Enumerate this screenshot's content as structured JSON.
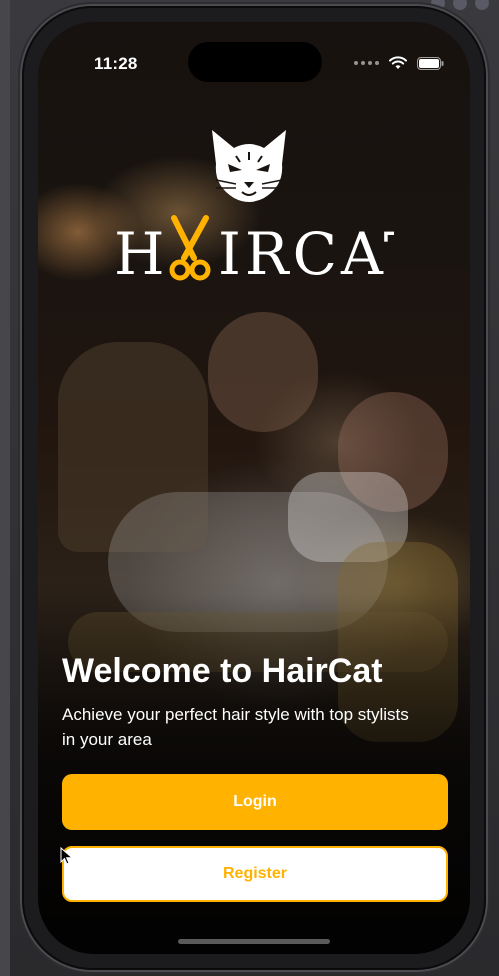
{
  "status_bar": {
    "time": "11:28",
    "signal_icon": "cellular-dots-icon",
    "wifi_icon": "wifi-icon",
    "battery_icon": "battery-icon"
  },
  "logo": {
    "brand_icon": "cat-head-icon",
    "scissors_icon": "scissors-icon",
    "accent_color": "#FFB300",
    "wordmark_text": "HAIRCAT"
  },
  "welcome": {
    "title": "Welcome to HairCat",
    "subtitle": "Achieve your perfect hair style with top stylists in your area"
  },
  "actions": {
    "login_label": "Login",
    "register_label": "Register"
  },
  "colors": {
    "accent": "#FFB300",
    "text_on_dark": "#FFFFFF",
    "register_bg": "#FFFFFF"
  }
}
